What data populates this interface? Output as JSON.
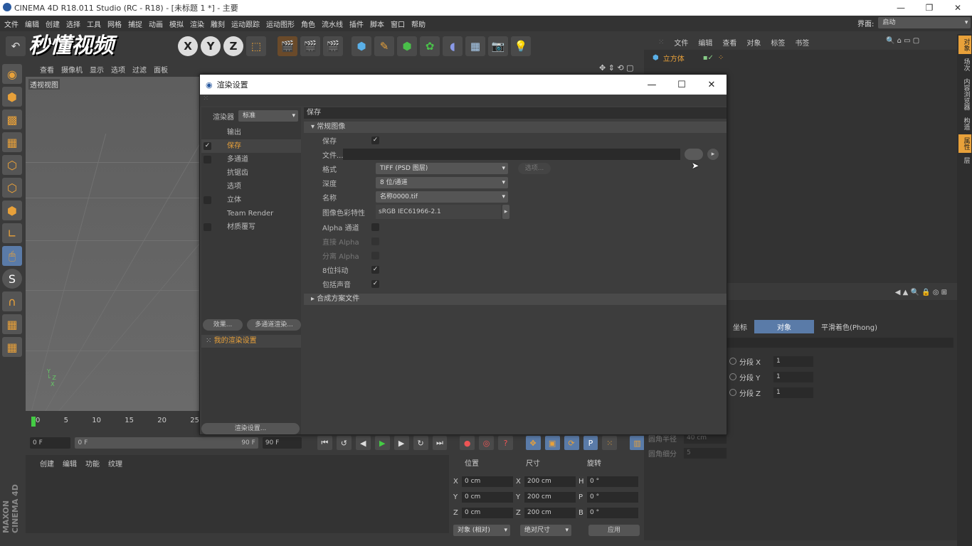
{
  "app": {
    "window_title": "CINEMA 4D R18.011 Studio (RC - R18) - [未标题 1 *] - 主要",
    "layout_label": "界面:",
    "layout_value": "启动"
  },
  "menubar": [
    "文件",
    "编辑",
    "创建",
    "选择",
    "工具",
    "网格",
    "捕捉",
    "动画",
    "模拟",
    "渲染",
    "雕刻",
    "运动跟踪",
    "运动图形",
    "角色",
    "流水线",
    "插件",
    "脚本",
    "窗口",
    "帮助"
  ],
  "watermark": "秒懂视频",
  "toolbar_axes": [
    "X",
    "Y",
    "Z"
  ],
  "viewport": {
    "menu": [
      "查看",
      "摄像机",
      "显示",
      "选项",
      "过滤",
      "面板"
    ],
    "label": "透视视图"
  },
  "timeline": {
    "ticks": [
      "0",
      "5",
      "10",
      "15",
      "20",
      "25"
    ],
    "start_field": "0 F",
    "range_start": "0 F",
    "range_end": "90 F",
    "end_field": "90 F"
  },
  "material_panel": {
    "menu": [
      "创建",
      "编辑",
      "功能",
      "纹理"
    ]
  },
  "coords": {
    "headers": [
      "位置",
      "尺寸",
      "旋转"
    ],
    "rows": [
      {
        "axis": "X",
        "pos": "0 cm",
        "saxis": "X",
        "size": "200 cm",
        "raxis": "H",
        "rot": "0 °"
      },
      {
        "axis": "Y",
        "pos": "0 cm",
        "saxis": "Y",
        "size": "200 cm",
        "raxis": "P",
        "rot": "0 °"
      },
      {
        "axis": "Z",
        "pos": "0 cm",
        "saxis": "Z",
        "size": "200 cm",
        "raxis": "B",
        "rot": "0 °"
      }
    ],
    "mode": "对象 (相对)",
    "size_mode": "绝对尺寸",
    "apply": "应用"
  },
  "object_manager": {
    "menu": [
      "文件",
      "编辑",
      "查看",
      "对象",
      "标签",
      "书签"
    ],
    "object": "立方体"
  },
  "attributes": {
    "tabs": [
      "坐标",
      "对象",
      "平滑着色(Phong)"
    ],
    "segments": [
      {
        "label": "分段 X",
        "value": "1"
      },
      {
        "label": "分段 Y",
        "value": "1"
      },
      {
        "label": "分段 Z",
        "value": "1"
      }
    ],
    "fillet_radius_label": "圆角半径",
    "fillet_radius": "40 cm",
    "fillet_sub_label": "圆角细分",
    "fillet_sub": "5"
  },
  "sidetabs": [
    "对象",
    "场次",
    "内容浏览器",
    "构造",
    "属性",
    "层"
  ],
  "brand": "MAXON CINEMA 4D",
  "dialog": {
    "title": "渲染设置",
    "renderer_label": "渲染器",
    "renderer_value": "标准",
    "tree": [
      {
        "label": "输出",
        "check": false,
        "has_check": false
      },
      {
        "label": "保存",
        "check": true,
        "has_check": true,
        "selected": true
      },
      {
        "label": "多通道",
        "check": false,
        "has_check": true
      },
      {
        "label": "抗锯齿",
        "check": false,
        "has_check": false
      },
      {
        "label": "选项",
        "check": false,
        "has_check": false
      },
      {
        "label": "立体",
        "check": false,
        "has_check": true
      },
      {
        "label": "Team Render",
        "check": false,
        "has_check": false
      },
      {
        "label": "材质覆写",
        "check": false,
        "has_check": true
      }
    ],
    "effects_btn": "效果...",
    "multipass_btn": "多通道渲染...",
    "preset": "我的渲染设置",
    "render_settings_btn": "渲染设置...",
    "panel_title": "保存",
    "section_regular": "常规图像",
    "save_label": "保存",
    "file_label": "文件...",
    "format_label": "格式",
    "format_value": "TIFF (PSD 图层)",
    "options_btn": "选项...",
    "depth_label": "深度",
    "depth_value": "8 位/通道",
    "name_label": "名称",
    "name_value": "名称0000.tif",
    "profile_label": "图像色彩特性",
    "profile_value": "sRGB IEC61966-2.1",
    "alpha_label": "Alpha 通道",
    "straight_alpha_label": "直接 Alpha",
    "separate_alpha_label": "分离 Alpha",
    "dither_label": "8位抖动",
    "sound_label": "包括声音",
    "section_compositing": "合成方案文件"
  }
}
